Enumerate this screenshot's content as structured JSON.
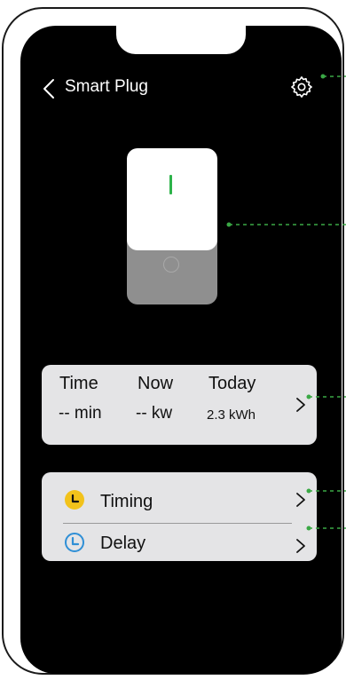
{
  "header": {
    "title": "Smart Plug",
    "back_icon": "chevron-left-icon",
    "settings_icon": "gear-icon"
  },
  "power_switch": {
    "state": "on",
    "on_indicator": "I",
    "off_indicator": "O"
  },
  "energy": {
    "columns": [
      {
        "label": "Time",
        "value": "-- min"
      },
      {
        "label": "Now",
        "value": "-- kw"
      },
      {
        "label": "Today",
        "value": "2.3 kWh"
      }
    ]
  },
  "menu": {
    "items": [
      {
        "label": "Timing",
        "icon": "clock-filled-yellow-icon"
      },
      {
        "label": "Delay",
        "icon": "clock-outline-blue-icon"
      }
    ]
  },
  "colors": {
    "screen_bg": "#000000",
    "card_bg": "#e4e4e6",
    "accent_green": "#2db34a",
    "timing_yellow": "#f2c21b",
    "delay_blue": "#2f8fd6",
    "annotation_green": "#3aa845"
  }
}
